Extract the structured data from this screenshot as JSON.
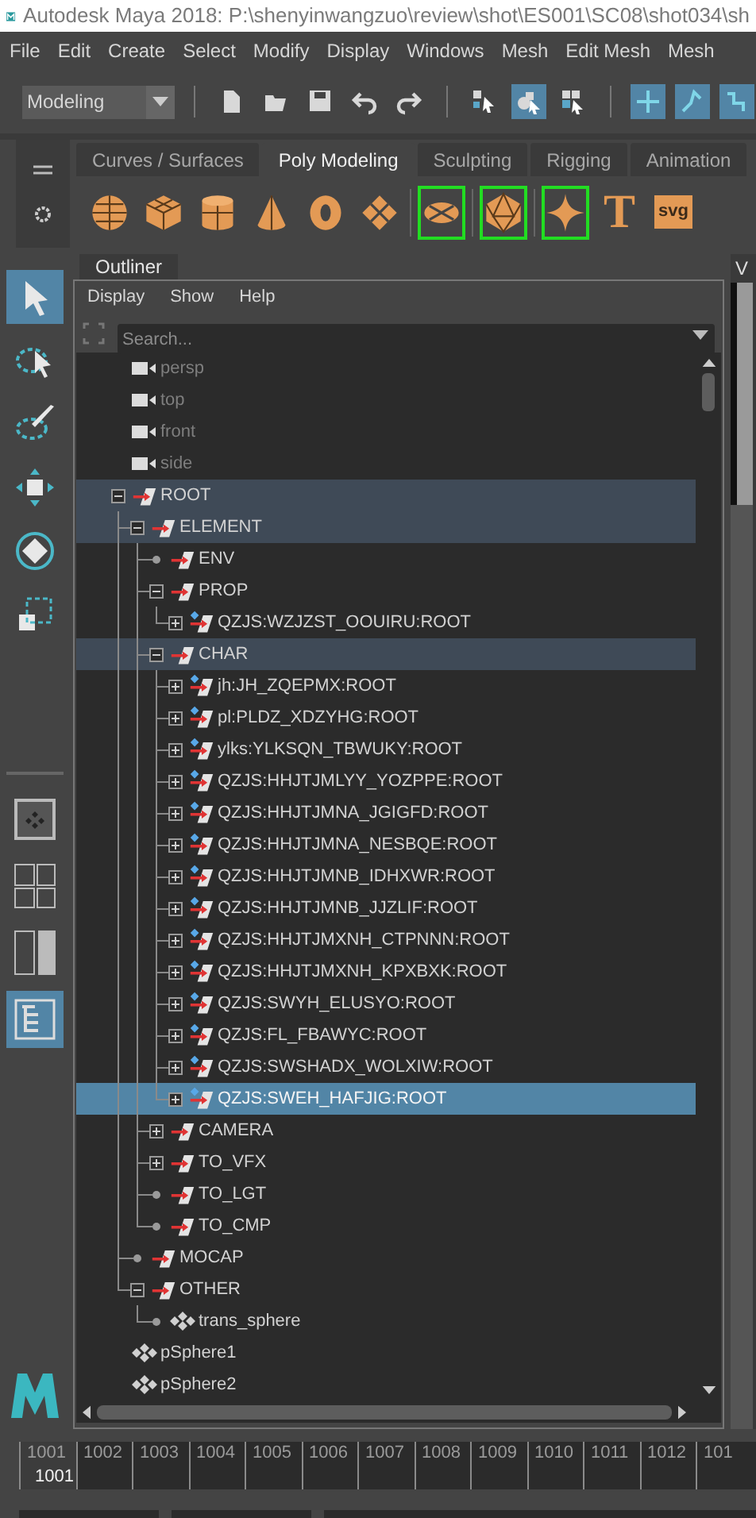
{
  "window": {
    "title": "Autodesk Maya 2018: P:\\shenyinwangzuo\\review\\shot\\ES001\\SC08\\shot034\\sh"
  },
  "menu_bar": [
    "File",
    "Edit",
    "Create",
    "Select",
    "Modify",
    "Display",
    "Windows",
    "Mesh",
    "Edit Mesh",
    "Mesh"
  ],
  "status_line": {
    "workspace": "Modeling",
    "button_groups": [
      [
        {
          "kind": "new",
          "on": false
        },
        {
          "kind": "open",
          "on": false
        },
        {
          "kind": "save",
          "on": false
        },
        {
          "kind": "undo",
          "on": false
        },
        {
          "kind": "redo",
          "on": false
        }
      ],
      [
        {
          "kind": "select-hierarchy",
          "on": false
        },
        {
          "kind": "select-object",
          "on": true
        },
        {
          "kind": "select-component",
          "on": false
        }
      ],
      [
        {
          "kind": "snap-grid",
          "on": true
        },
        {
          "kind": "snap-curve",
          "on": true
        },
        {
          "kind": "snap-point",
          "on": true
        }
      ]
    ]
  },
  "shelf": {
    "tabs": [
      {
        "label": "Curves / Surfaces",
        "selected": false
      },
      {
        "label": "Poly Modeling",
        "selected": true
      },
      {
        "label": "Sculpting",
        "selected": false
      },
      {
        "label": "Rigging",
        "selected": false
      },
      {
        "label": "Animation",
        "selected": false
      }
    ],
    "tools": [
      {
        "kind": "sphere",
        "framed": false
      },
      {
        "kind": "cube",
        "framed": false
      },
      {
        "kind": "cylinder",
        "framed": false
      },
      {
        "kind": "cone",
        "framed": false
      },
      {
        "kind": "torus",
        "framed": false
      },
      {
        "kind": "plane",
        "framed": false
      },
      {
        "kind": "disc",
        "framed": true
      },
      {
        "kind": "platonic",
        "framed": true
      },
      {
        "kind": "star",
        "framed": true
      },
      {
        "kind": "text",
        "label": "T",
        "framed": false
      },
      {
        "kind": "svg",
        "label": "svg",
        "framed": false
      }
    ]
  },
  "toolbox": {
    "tools": [
      {
        "kind": "select",
        "selected": true
      },
      {
        "kind": "lasso",
        "selected": false
      },
      {
        "kind": "paint",
        "selected": false
      },
      {
        "kind": "move",
        "selected": false
      },
      {
        "kind": "rotate",
        "selected": false
      },
      {
        "kind": "scale",
        "selected": false
      }
    ],
    "layouts": [
      {
        "kind": "single",
        "selected": false
      },
      {
        "kind": "four",
        "selected": false
      },
      {
        "kind": "two",
        "selected": false
      },
      {
        "kind": "outliner",
        "selected": true
      }
    ]
  },
  "outliner": {
    "tab": "Outliner",
    "menu": [
      "Display",
      "Show",
      "Help"
    ],
    "search": {
      "placeholder": "Search..."
    },
    "items": [
      {
        "name": "persp",
        "kind": "camera",
        "dimmed": true,
        "selected": false
      },
      {
        "name": "top",
        "kind": "camera",
        "dimmed": true,
        "selected": false
      },
      {
        "name": "front",
        "kind": "camera",
        "dimmed": true,
        "selected": false
      },
      {
        "name": "side",
        "kind": "camera",
        "dimmed": true,
        "selected": false
      },
      {
        "name": "ROOT",
        "kind": "group",
        "dimmed": false,
        "selected": false,
        "expanded": true,
        "children": [
          {
            "name": "ELEMENT",
            "kind": "group",
            "selected": false,
            "expanded": true,
            "children": [
              {
                "name": "ENV",
                "kind": "group",
                "selected": false
              },
              {
                "name": "PROP",
                "kind": "group",
                "selected": false,
                "expanded": true,
                "children": [
                  {
                    "name": "QZJS:WZJZST_OOUIRU:ROOT",
                    "kind": "reference",
                    "selected": false,
                    "expanded": false
                  }
                ]
              },
              {
                "name": "CHAR",
                "kind": "group",
                "selected": false,
                "expanded": true,
                "children": [
                  {
                    "name": "jh:JH_ZQEPMX:ROOT",
                    "kind": "reference",
                    "selected": false,
                    "expanded": false
                  },
                  {
                    "name": "pl:PLDZ_XDZYHG:ROOT",
                    "kind": "reference",
                    "selected": false,
                    "expanded": false
                  },
                  {
                    "name": "ylks:YLKSQN_TBWUKY:ROOT",
                    "kind": "reference",
                    "selected": false,
                    "expanded": false
                  },
                  {
                    "name": "QZJS:HHJTJMLYY_YOZPPE:ROOT",
                    "kind": "reference",
                    "selected": false,
                    "expanded": false
                  },
                  {
                    "name": "QZJS:HHJTJMNA_JGIGFD:ROOT",
                    "kind": "reference",
                    "selected": false,
                    "expanded": false
                  },
                  {
                    "name": "QZJS:HHJTJMNA_NESBQE:ROOT",
                    "kind": "reference",
                    "selected": false,
                    "expanded": false
                  },
                  {
                    "name": "QZJS:HHJTJMNB_IDHXWR:ROOT",
                    "kind": "reference",
                    "selected": false,
                    "expanded": false
                  },
                  {
                    "name": "QZJS:HHJTJMNB_JJZLIF:ROOT",
                    "kind": "reference",
                    "selected": false,
                    "expanded": false
                  },
                  {
                    "name": "QZJS:HHJTJMXNH_CTPNNN:ROOT",
                    "kind": "reference",
                    "selected": false,
                    "expanded": false
                  },
                  {
                    "name": "QZJS:HHJTJMXNH_KPXBXK:ROOT",
                    "kind": "reference",
                    "selected": false,
                    "expanded": false
                  },
                  {
                    "name": "QZJS:SWYH_ELUSYO:ROOT",
                    "kind": "reference",
                    "selected": false,
                    "expanded": false
                  },
                  {
                    "name": "QZJS:FL_FBAWYC:ROOT",
                    "kind": "reference",
                    "selected": false,
                    "expanded": false
                  },
                  {
                    "name": "QZJS:SWSHADX_WOLXIW:ROOT",
                    "kind": "reference",
                    "selected": false,
                    "expanded": false
                  },
                  {
                    "name": "QZJS:SWEH_HAFJIG:ROOT",
                    "kind": "reference",
                    "selected": true,
                    "expanded": false
                  }
                ]
              },
              {
                "name": "CAMERA",
                "kind": "group",
                "selected": false,
                "expanded": false
              },
              {
                "name": "TO_VFX",
                "kind": "group",
                "selected": false,
                "expanded": false
              },
              {
                "name": "TO_LGT",
                "kind": "group",
                "selected": false
              },
              {
                "name": "TO_CMP",
                "kind": "group",
                "selected": false
              }
            ]
          },
          {
            "name": "MOCAP",
            "kind": "group",
            "selected": false
          },
          {
            "name": "OTHER",
            "kind": "group",
            "selected": false,
            "expanded": true,
            "children": [
              {
                "name": "trans_sphere",
                "kind": "mesh",
                "selected": false
              }
            ]
          }
        ]
      },
      {
        "name": "pSphere1",
        "kind": "mesh",
        "dimmed": false,
        "selected": false
      },
      {
        "name": "pSphere2",
        "kind": "mesh",
        "dimmed": false,
        "selected": false
      }
    ]
  },
  "viewport": {
    "menu_label": "V"
  },
  "timeline": {
    "frames": [
      {
        "label": "1001",
        "selected": true
      },
      {
        "label": "1002",
        "selected": false
      },
      {
        "label": "1003",
        "selected": false
      },
      {
        "label": "1004",
        "selected": false
      },
      {
        "label": "1005",
        "selected": false
      },
      {
        "label": "1006",
        "selected": false
      },
      {
        "label": "1007",
        "selected": false
      },
      {
        "label": "1008",
        "selected": false
      },
      {
        "label": "1009",
        "selected": false
      },
      {
        "label": "1010",
        "selected": false
      },
      {
        "label": "1011",
        "selected": false
      },
      {
        "label": "1012",
        "selected": false
      },
      {
        "label": "101",
        "selected": false
      }
    ],
    "current_frame": "1001"
  }
}
